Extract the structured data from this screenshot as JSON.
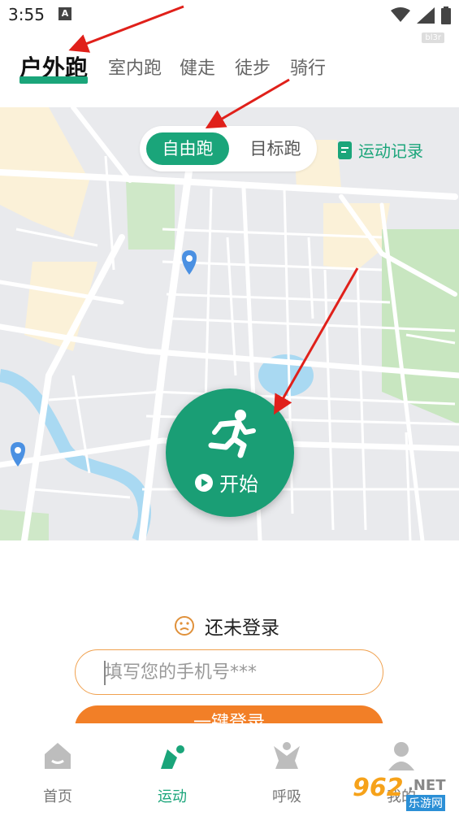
{
  "status_bar": {
    "time": "3:55",
    "notification_letter": "A"
  },
  "top_watermark": "bl3r",
  "tabs": [
    {
      "label": "户外跑",
      "active": true
    },
    {
      "label": "室内跑",
      "active": false
    },
    {
      "label": "健走",
      "active": false
    },
    {
      "label": "徒步",
      "active": false
    },
    {
      "label": "骑行",
      "active": false
    }
  ],
  "mode_toggle": {
    "free": "自由跑",
    "target": "目标跑",
    "selected": "free"
  },
  "record_link": {
    "label": "运动记录",
    "icon": "record-icon"
  },
  "start_button": {
    "label": "开始",
    "icon": "runner-icon"
  },
  "login": {
    "status": "还未登录",
    "phone_placeholder": "填写您的手机号***",
    "button_label": "一键登录"
  },
  "bottom_nav": [
    {
      "label": "首页",
      "icon": "home-icon",
      "active": false
    },
    {
      "label": "运动",
      "icon": "sport-icon",
      "active": true
    },
    {
      "label": "呼吸",
      "icon": "breath-icon",
      "active": false
    },
    {
      "label": "我的",
      "icon": "profile-icon",
      "active": false
    }
  ],
  "site_watermark": {
    "number": "962",
    "suffix": ".NET",
    "chinese": "乐游网"
  },
  "colors": {
    "accent": "#1aa57a",
    "start": "#1a9e75",
    "login": "#f27f27",
    "arrow": "#e0201a"
  }
}
